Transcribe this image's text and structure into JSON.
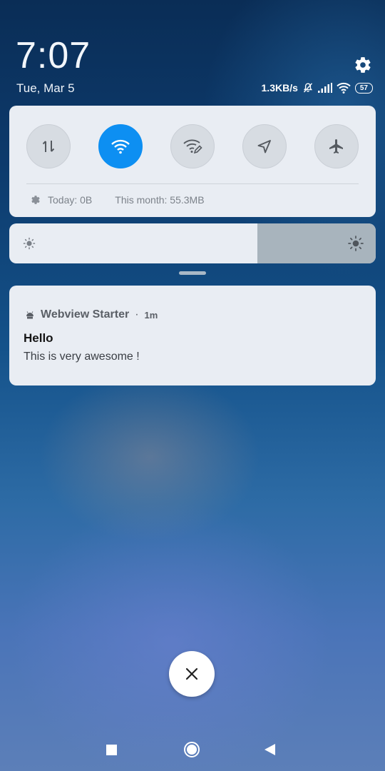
{
  "lockscreen": {
    "time": "7:07",
    "date": "Tue, Mar 5"
  },
  "status": {
    "net_speed": "1.3KB/s",
    "battery": "57"
  },
  "quick_settings": {
    "tiles": [
      {
        "name": "mobile-data",
        "icon": "data-arrows-icon",
        "active": false
      },
      {
        "name": "wifi",
        "icon": "wifi-icon",
        "active": true
      },
      {
        "name": "hotspot",
        "icon": "wifi-edit-icon",
        "active": false
      },
      {
        "name": "location",
        "icon": "location-arrow-icon",
        "active": false
      },
      {
        "name": "airplane-mode",
        "icon": "airplane-icon",
        "active": false
      }
    ],
    "usage_today": "Today: 0B",
    "usage_month": "This month: 55.3MB"
  },
  "brightness": {
    "level": 0.68
  },
  "notification": {
    "app": "Webview Starter",
    "time": "1m",
    "title": "Hello",
    "text": "This is very awesome !"
  },
  "colors": {
    "accent": "#0d8ff2",
    "panel": "#e9edf3"
  }
}
